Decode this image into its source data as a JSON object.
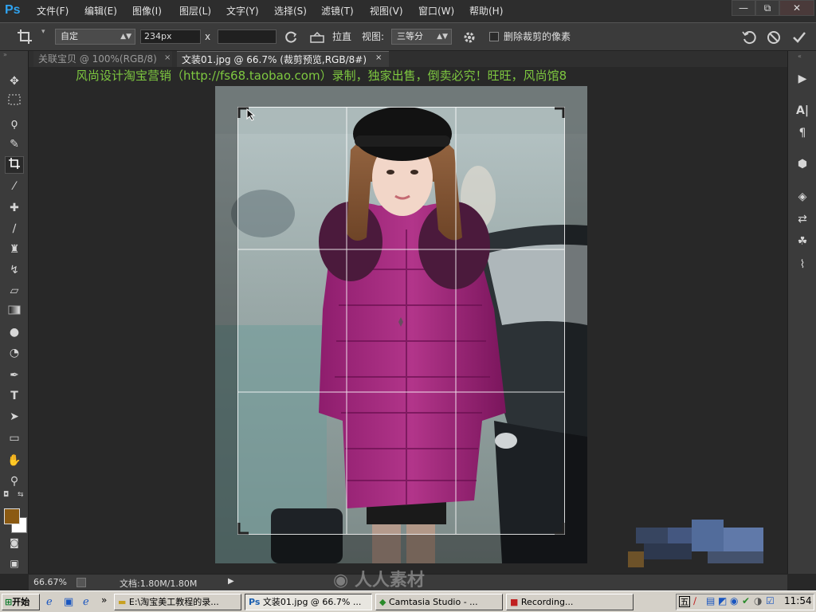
{
  "app": {
    "logo": "Ps"
  },
  "menu": [
    "文件(F)",
    "编辑(E)",
    "图像(I)",
    "图层(L)",
    "文字(Y)",
    "选择(S)",
    "滤镜(T)",
    "视图(V)",
    "窗口(W)",
    "帮助(H)"
  ],
  "window_controls": {
    "minimize": "—",
    "restore": "⧉",
    "close": "✕"
  },
  "options": {
    "preset_value": "自定",
    "width_value": "234px",
    "times_sign": "x",
    "height_value": "",
    "straighten_label": "拉直",
    "view_label": "视图:",
    "view_value": "三等分",
    "delete_cropped_label": "删除裁剪的像素",
    "delete_cropped_checked": false
  },
  "tabs": [
    {
      "label": "关联宝贝 @ 100%(RGB/8)",
      "active": false
    },
    {
      "label": "文装01.jpg @ 66.7% (裁剪预览,RGB/8#)",
      "active": true
    }
  ],
  "watermark_text": "风尚设计淘宝营销（http://fs68.taobao.com）录制，独家出售，倒卖必究！旺旺，风尚馆8",
  "tools": [
    "move-icon",
    "marquee-icon",
    "lasso-icon",
    "quick-select-icon",
    "crop-icon",
    "eyedropper-icon",
    "healing-icon",
    "brush-icon",
    "stamp-icon",
    "history-brush-icon",
    "eraser-icon",
    "gradient-icon",
    "blur-icon",
    "dodge-icon",
    "pen-icon",
    "type-icon",
    "path-select-icon",
    "rectangle-icon",
    "hand-icon",
    "zoom-icon"
  ],
  "colors": {
    "foreground": "#8b5a12",
    "background": "#ffffff",
    "accent": "#2fa3f0",
    "watermark": "#7ec840"
  },
  "status": {
    "zoom": "66.67%",
    "doc": "文档:1.80M/1.80M"
  },
  "center_watermark": "人人素材",
  "taskbar": {
    "start": "开始",
    "buttons": [
      "E:\\淘宝美工教程的录...",
      "文装01.jpg @ 66.7% ...",
      "Camtasia Studio - ...",
      "Recording..."
    ],
    "time": "11:54",
    "tray_ime": "五"
  }
}
